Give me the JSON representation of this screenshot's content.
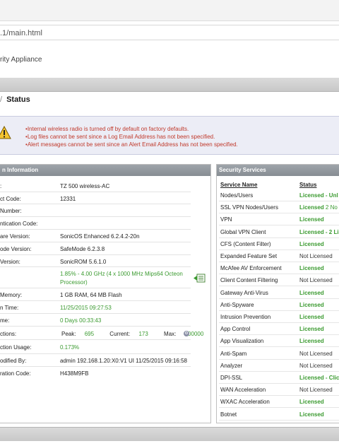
{
  "browser": {
    "url": ".1/main.html"
  },
  "app": {
    "title": "rity Appliance"
  },
  "breadcrumb": {
    "separator": "/",
    "current": "Status"
  },
  "alerts": [
    "Internal wireless radio is turned off by default on factory defaults.",
    "Log files cannot be sent since a Log Email Address has not been specified.",
    "Alert messages cannot be sent since an Alert Email Address has not been specified."
  ],
  "system_panel": {
    "title": "n Information",
    "rows": [
      {
        "label": ":",
        "value": "TZ 500 wireless-AC"
      },
      {
        "label": "ct Code:",
        "value": "12331"
      },
      {
        "label": "Number:",
        "value": ""
      },
      {
        "label": "ntication Code:",
        "value": ""
      },
      {
        "label": "are Version:",
        "value": "SonicOS Enhanced 6.2.4.2-20n"
      },
      {
        "label": "ode Version:",
        "value": "SafeMode 6.2.3.8"
      },
      {
        "label": "Version:",
        "value": "SonicROM 5.6.1.0"
      },
      {
        "label": "",
        "value": "1.85% - 4.00 GHz (4 x 1000 MHz Mips64 Octeon Processor)"
      },
      {
        "label": "Memory:",
        "value": "1 GB RAM, 64 MB Flash"
      },
      {
        "label": "n Time:",
        "value": "11/25/2015 09:27:53"
      },
      {
        "label": "me:",
        "value": "0 Days 00:33:43"
      },
      {
        "label": "ctions:",
        "value": ""
      },
      {
        "label": "ction Usage:",
        "value": "0.173%"
      },
      {
        "label": "odified By:",
        "value": "admin 192.168.1.20:X0:V1 UI 11/25/2015 09:16:58"
      },
      {
        "label": "ration Code:",
        "value": "H438M9FB"
      }
    ],
    "connections": {
      "peak_label": "Peak:",
      "peak": "695",
      "current_label": "Current:",
      "current": "173",
      "max_label": "Max:",
      "max": "100000"
    }
  },
  "security_panel": {
    "title": "Security Services",
    "col_name": "Service Name",
    "col_status": "Status",
    "rows": [
      {
        "name": "Nodes/Users",
        "status": "Licensed",
        "extra": " - Unl",
        "licensed": true
      },
      {
        "name": "SSL VPN Nodes/Users",
        "status": "Licensed",
        "extra": " 2 No",
        "licensed": true
      },
      {
        "name": "VPN",
        "status": "Licensed",
        "extra": "",
        "licensed": true
      },
      {
        "name": "Global VPN Client",
        "status": "Licensed",
        "extra": " - 2 Li",
        "licensed": true
      },
      {
        "name": "CFS (Content Filter)",
        "status": "Licensed",
        "extra": "",
        "licensed": true
      },
      {
        "name": "Expanded Feature Set",
        "status": "Not Licensed",
        "extra": "",
        "licensed": false
      },
      {
        "name": "McAfee AV Enforcement",
        "status": "Licensed",
        "extra": "",
        "licensed": true
      },
      {
        "name": "Client Content Filtering",
        "status": "Not Licensed",
        "extra": "",
        "licensed": false
      },
      {
        "name": "Gateway Anti-Virus",
        "status": "Licensed",
        "extra": "",
        "licensed": true
      },
      {
        "name": "Anti-Spyware",
        "status": "Licensed",
        "extra": "",
        "licensed": true
      },
      {
        "name": "Intrusion Prevention",
        "status": "Licensed",
        "extra": "",
        "licensed": true
      },
      {
        "name": "App Control",
        "status": "Licensed",
        "extra": "",
        "licensed": true
      },
      {
        "name": "App Visualization",
        "status": "Licensed",
        "extra": "",
        "licensed": true
      },
      {
        "name": "Anti-Spam",
        "status": "Not Licensed",
        "extra": "",
        "licensed": false
      },
      {
        "name": "Analyzer",
        "status": "Not Licensed",
        "extra": "",
        "licensed": false
      },
      {
        "name": "DPI-SSL",
        "status": "Licensed",
        "extra": " - Clic",
        "licensed": true
      },
      {
        "name": "WAN Acceleration",
        "status": "Not Licensed",
        "extra": "",
        "licensed": false
      },
      {
        "name": "WXAC Acceleration",
        "status": "Licensed",
        "extra": "",
        "licensed": true
      },
      {
        "name": "Botnet",
        "status": "Licensed",
        "extra": "",
        "licensed": true
      }
    ]
  },
  "colors": {
    "licensed": "#3a9a2f",
    "alert_text": "#c0392b",
    "panel_header": "#878d93"
  },
  "icons": {
    "warning": "warning-icon",
    "processor_monitor": "processor-monitor-icon",
    "connections_info": "gear-icon"
  }
}
